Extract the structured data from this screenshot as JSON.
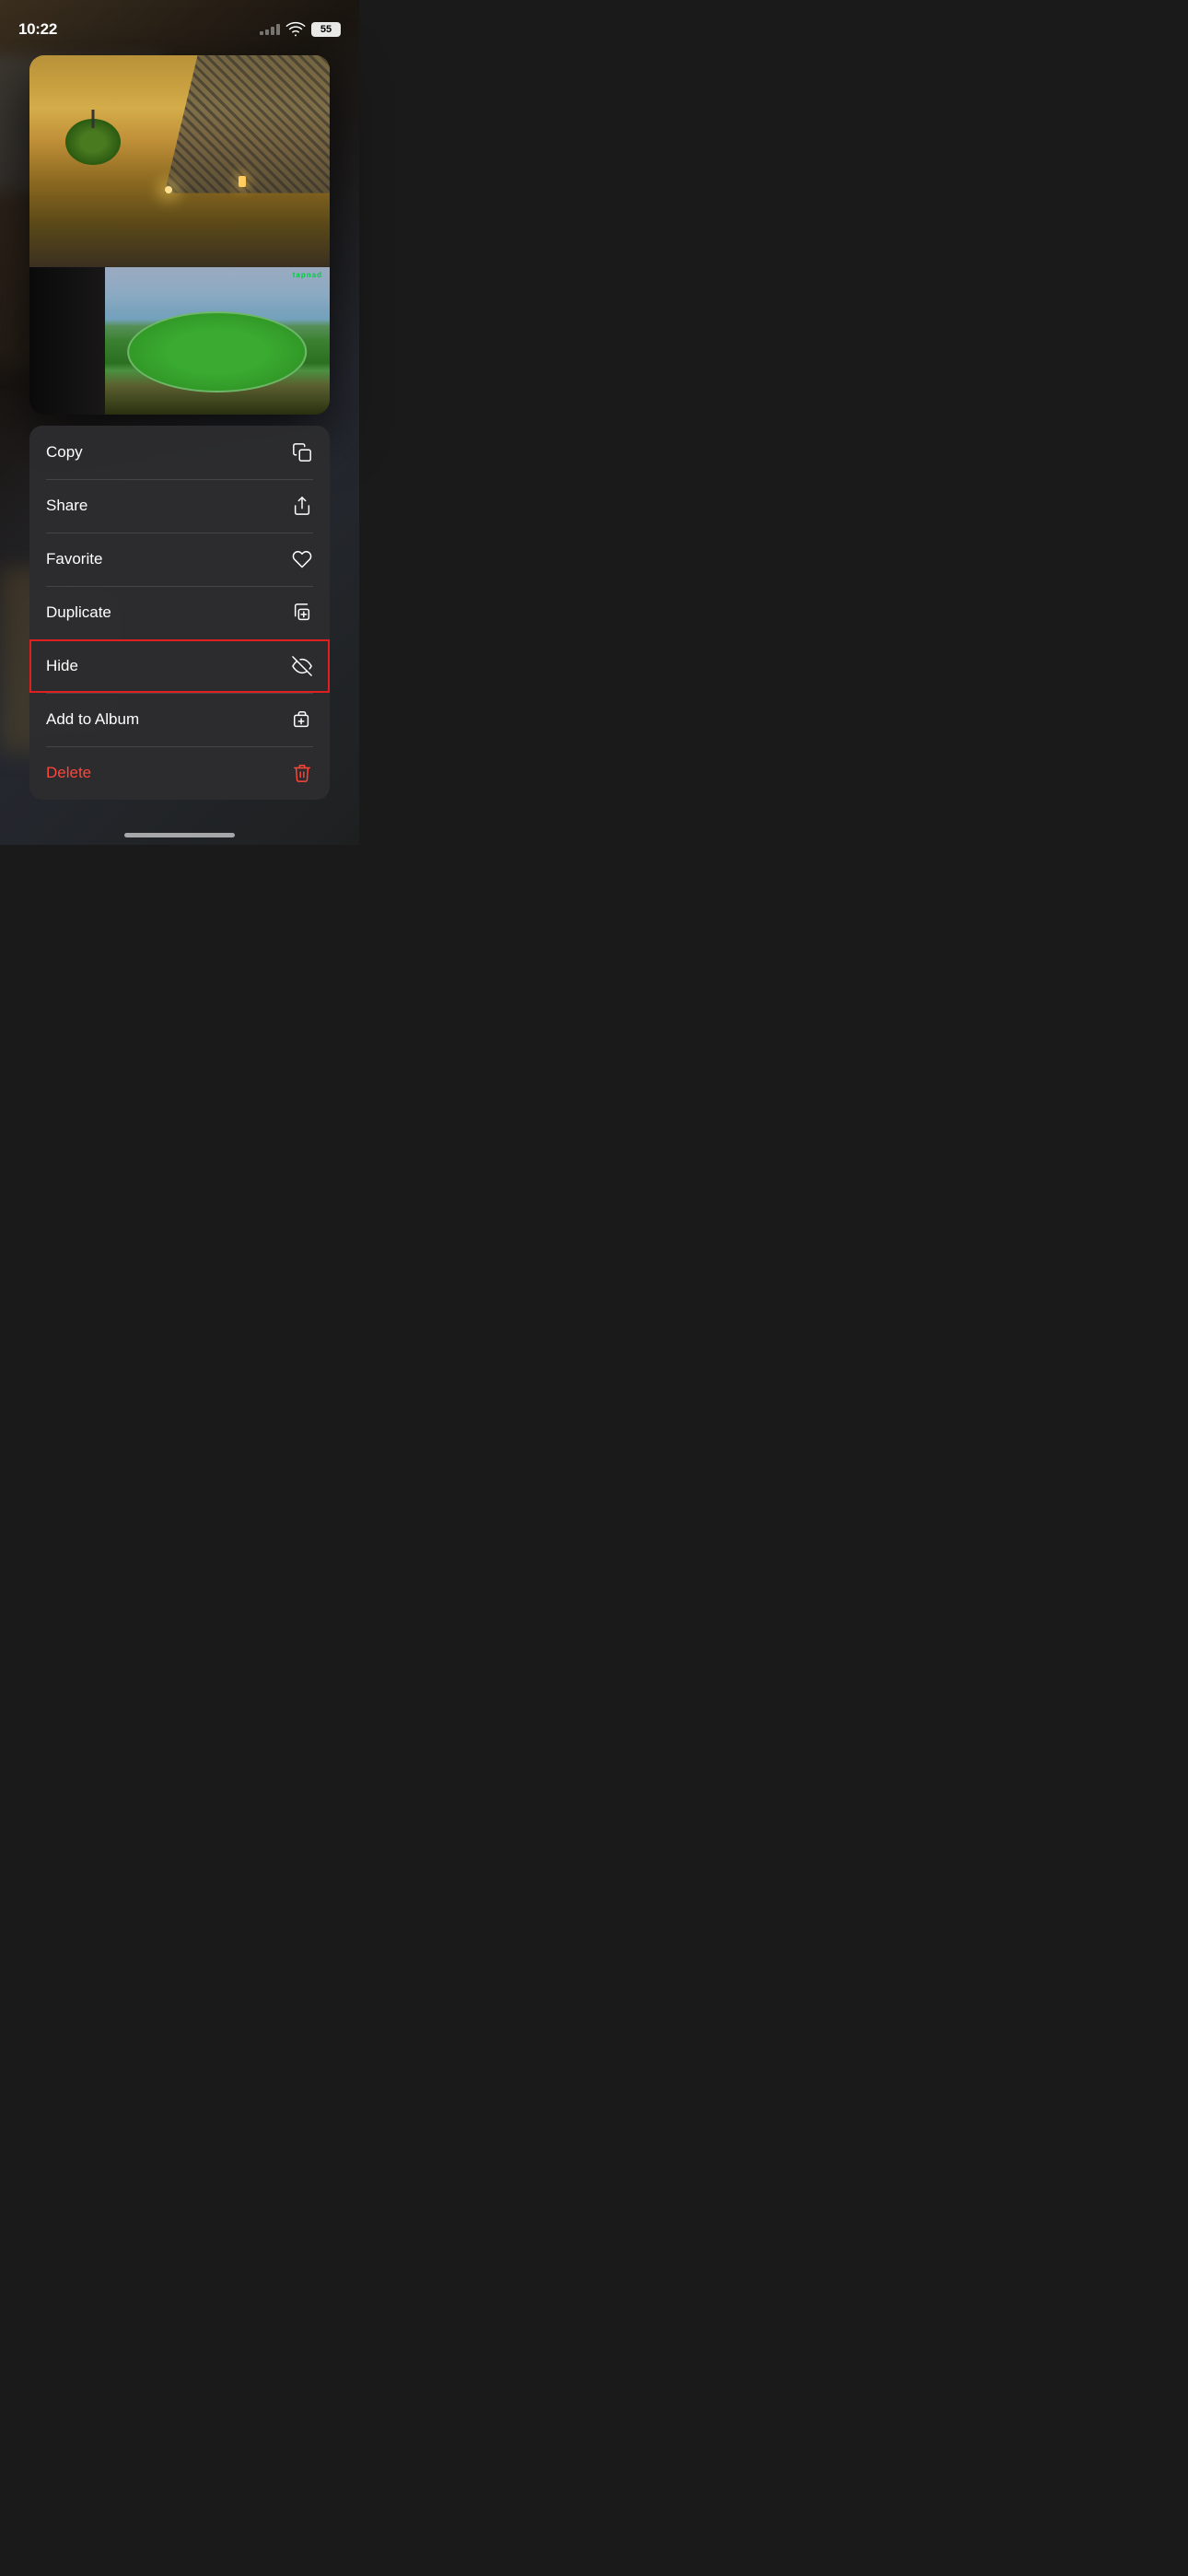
{
  "statusBar": {
    "time": "10:22",
    "battery": "55",
    "batteryLabel": "55"
  },
  "photo": {
    "altText": "Room interior with cricket stadium on TV"
  },
  "contextMenu": {
    "items": [
      {
        "id": "copy",
        "label": "Copy",
        "icon": "copy-icon",
        "highlighted": false,
        "isDelete": false
      },
      {
        "id": "share",
        "label": "Share",
        "icon": "share-icon",
        "highlighted": false,
        "isDelete": false
      },
      {
        "id": "favorite",
        "label": "Favorite",
        "icon": "heart-icon",
        "highlighted": false,
        "isDelete": false
      },
      {
        "id": "duplicate",
        "label": "Duplicate",
        "icon": "duplicate-icon",
        "highlighted": false,
        "isDelete": false
      },
      {
        "id": "hide",
        "label": "Hide",
        "icon": "hide-icon",
        "highlighted": true,
        "isDelete": false
      },
      {
        "id": "add-to-album",
        "label": "Add to Album",
        "icon": "add-album-icon",
        "highlighted": false,
        "isDelete": false
      },
      {
        "id": "delete",
        "label": "Delete",
        "icon": "trash-icon",
        "highlighted": false,
        "isDelete": true
      }
    ]
  }
}
